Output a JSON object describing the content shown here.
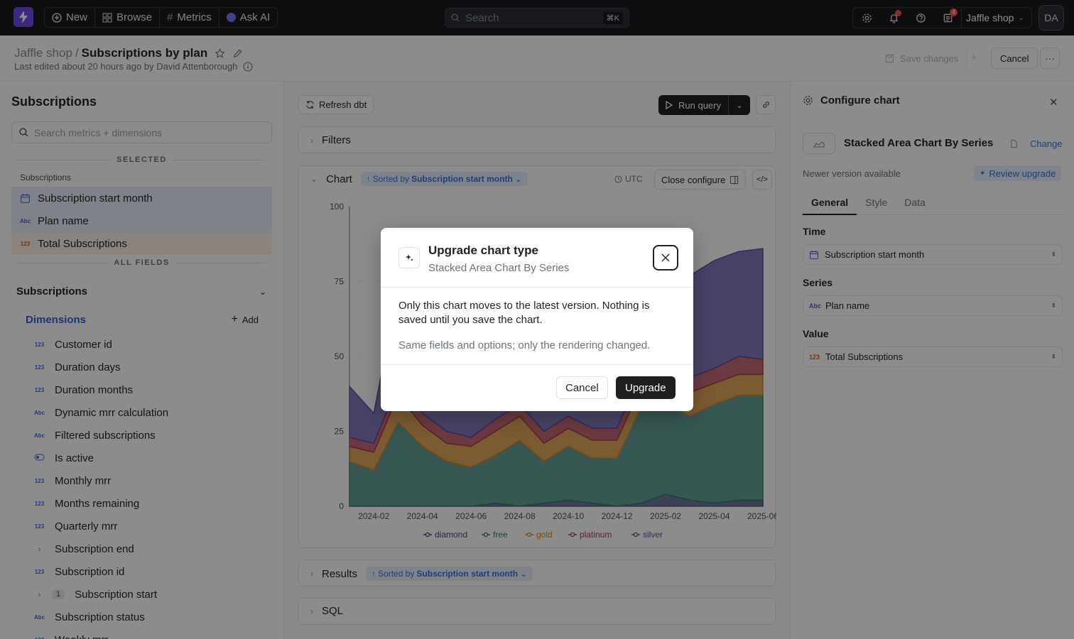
{
  "nav": {
    "new_label": "New",
    "browse_label": "Browse",
    "metrics_label": "Metrics",
    "askai_label": "Ask AI",
    "search_placeholder": "Search",
    "search_shortcut": "⌘K",
    "notif_badge": "4",
    "project_label": "Jaffle shop",
    "avatar_initials": "DA"
  },
  "header": {
    "crumb_project": "Jaffle shop",
    "crumb_sep": "/",
    "title": "Subscriptions by plan",
    "edited": "Last edited about 20 hours ago by David Attenborough",
    "save_label": "Save changes",
    "cancel_label": "Cancel"
  },
  "sidebar": {
    "title": "Subscriptions",
    "search_placeholder": "Search metrics + dimensions",
    "selected_label": "SELECTED",
    "selected_table": "Subscriptions",
    "selected": [
      {
        "icon": "calendar-icon",
        "label": "Subscription start month",
        "kind": "dimension"
      },
      {
        "icon": "Abc",
        "label": "Plan name",
        "kind": "dimension"
      },
      {
        "icon": "123",
        "label": "Total Subscriptions",
        "kind": "metric"
      }
    ],
    "all_fields_label": "ALL FIELDS",
    "group_title": "Subscriptions",
    "dimensions_label": "Dimensions",
    "add_label": "Add",
    "fields": [
      {
        "icon": "123",
        "label": "Customer id"
      },
      {
        "icon": "123",
        "label": "Duration days"
      },
      {
        "icon": "123",
        "label": "Duration months"
      },
      {
        "icon": "Abc",
        "label": "Dynamic mrr calculation"
      },
      {
        "icon": "Abc",
        "label": "Filtered subscriptions"
      },
      {
        "icon": "toggle",
        "label": "Is active"
      },
      {
        "icon": "123",
        "label": "Monthly mrr"
      },
      {
        "icon": "123",
        "label": "Months remaining"
      },
      {
        "icon": "123",
        "label": "Quarterly mrr"
      },
      {
        "icon": "chevron",
        "label": "Subscription end"
      },
      {
        "icon": "123",
        "label": "Subscription id"
      },
      {
        "icon": "chevron",
        "label": "Subscription start",
        "count": "1"
      },
      {
        "icon": "Abc",
        "label": "Subscription status"
      },
      {
        "icon": "123",
        "label": "Weekly mrr"
      }
    ]
  },
  "center": {
    "refresh_label": "Refresh dbt",
    "run_label": "Run query",
    "filters_label": "Filters",
    "chart_label": "Chart",
    "sorted_by": "Sorted by",
    "sort_field": "Subscription start month",
    "timezone": "UTC",
    "close_configure": "Close configure",
    "results_label": "Results",
    "sql_label": "SQL"
  },
  "chart_data": {
    "type": "area",
    "stacked": true,
    "x": [
      "2024-01",
      "2024-02",
      "2024-03",
      "2024-04",
      "2024-05",
      "2024-06",
      "2024-07",
      "2024-08",
      "2024-09",
      "2024-10",
      "2024-11",
      "2024-12",
      "2025-01",
      "2025-02",
      "2025-03",
      "2025-04",
      "2025-05",
      "2025-06"
    ],
    "x_tick_labels": [
      "2024-02",
      "2024-04",
      "2024-06",
      "2024-08",
      "2024-10",
      "2024-12",
      "2025-02",
      "2025-04",
      "2025-06"
    ],
    "ylim": [
      0,
      100
    ],
    "y_ticks": [
      0,
      25,
      50,
      75,
      100
    ],
    "series": [
      {
        "name": "diamond",
        "color": "#3f4a7a",
        "values": [
          0,
          0,
          0,
          0,
          0,
          0,
          1,
          0,
          1,
          2,
          1,
          0,
          1,
          4,
          2,
          1,
          2,
          2
        ]
      },
      {
        "name": "free",
        "color": "#2f7f73",
        "values": [
          15,
          12,
          28,
          20,
          15,
          13,
          16,
          22,
          14,
          18,
          15,
          16,
          32,
          30,
          28,
          33,
          35,
          35
        ]
      },
      {
        "name": "gold",
        "color": "#d68a25",
        "values": [
          5,
          6,
          9,
          7,
          6,
          7,
          8,
          8,
          6,
          6,
          6,
          6,
          7,
          7,
          8,
          7,
          7,
          7
        ]
      },
      {
        "name": "platinum",
        "color": "#b03a48",
        "values": [
          3,
          3,
          4,
          4,
          4,
          3,
          4,
          4,
          4,
          4,
          4,
          4,
          5,
          6,
          5,
          5,
          6,
          5
        ]
      },
      {
        "name": "silver",
        "color": "#5b4ea3",
        "values": [
          17,
          10,
          32,
          28,
          30,
          26,
          34,
          33,
          35,
          33,
          37,
          30,
          35,
          38,
          34,
          36,
          35,
          37
        ]
      }
    ],
    "legend_position": "bottom",
    "grid": true
  },
  "config": {
    "title": "Configure chart",
    "chart_type_name": "Stacked Area Chart By Series",
    "change_label": "Change",
    "newer_label": "Newer version available",
    "review_label": "Review upgrade",
    "tabs": [
      "General",
      "Style",
      "Data"
    ],
    "time_label": "Time",
    "time_value": "Subscription start month",
    "series_label": "Series",
    "series_value": "Plan name",
    "value_label": "Value",
    "value_value": "Total Subscriptions"
  },
  "modal": {
    "title": "Upgrade chart type",
    "subtitle": "Stacked Area Chart By Series",
    "body1": "Only this chart moves to the latest version. Nothing is saved until you save the chart.",
    "body2": "Same fields and options; only the rendering changed.",
    "cancel_label": "Cancel",
    "upgrade_label": "Upgrade"
  }
}
